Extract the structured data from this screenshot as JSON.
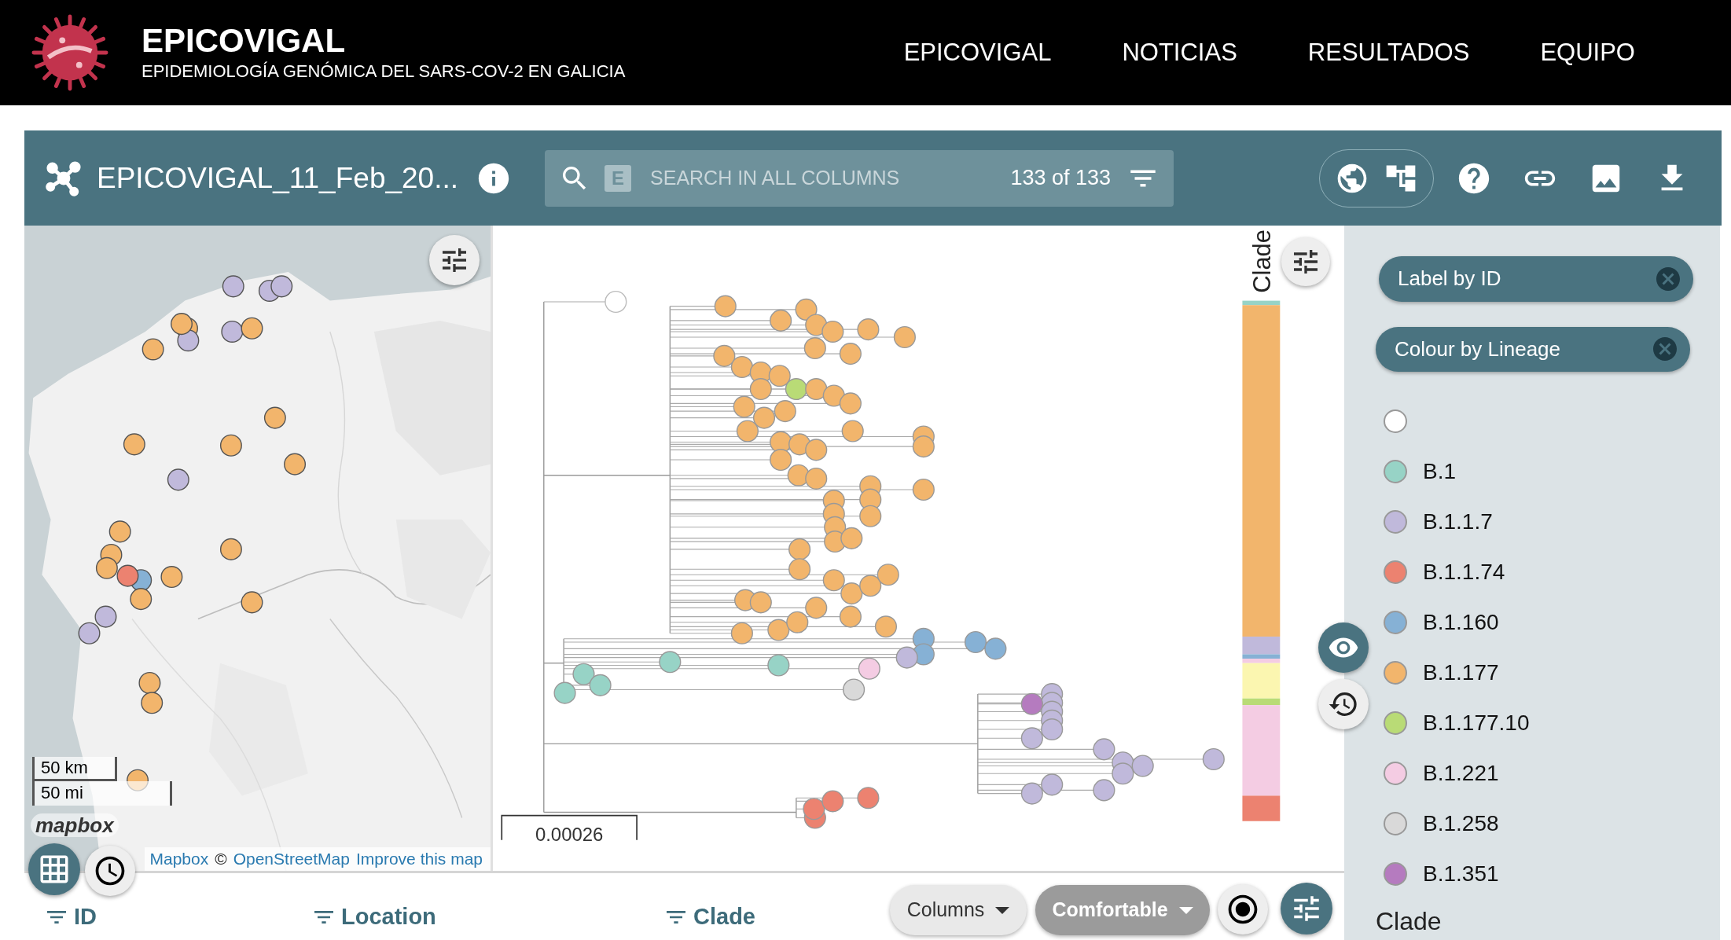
{
  "header": {
    "site_title": "EPICOVIGAL",
    "subtitle": "EPIDEMIOLOGÍA GENÓMICA DEL SARS-COV-2 EN GALICIA",
    "nav": [
      {
        "label": "EPICOVIGAL"
      },
      {
        "label": "NOTICIAS"
      },
      {
        "label": "RESULTADOS"
      },
      {
        "label": "EQUIPO"
      }
    ]
  },
  "toolbar": {
    "title": "EPICOVIGAL_11_Feb_20...",
    "search": {
      "badge": "E",
      "placeholder": "SEARCH IN ALL COLUMNS",
      "count": "133 of 133"
    }
  },
  "map": {
    "scale": [
      "50 km",
      "50 mi"
    ],
    "logo": "mapbox",
    "attribution": [
      {
        "text": "Mapbox",
        "kind": "link"
      },
      {
        "text": "©",
        "kind": "text"
      },
      {
        "text": "OpenStreetMap",
        "kind": "link"
      },
      {
        "text": "Improve this map",
        "kind": "link"
      }
    ]
  },
  "tree": {
    "scale_label": "0.00026",
    "strip_label": "Clade"
  },
  "legend": {
    "chips": [
      "Label by ID",
      "Colour by Lineage"
    ],
    "items": [
      {
        "color": "#ffffff"
      },
      {
        "label": "B.1",
        "color": "#97d3c6"
      },
      {
        "label": "B.1.1.7",
        "color": "#c0b9db"
      },
      {
        "label": "B.1.1.74",
        "color": "#ec8270"
      },
      {
        "label": "B.1.160",
        "color": "#86b1d5"
      },
      {
        "label": "B.1.177",
        "color": "#f2b56c"
      },
      {
        "label": "B.1.177.10",
        "color": "#b9db76"
      },
      {
        "label": "B.1.221",
        "color": "#f4cce3"
      },
      {
        "label": "B.1.258",
        "color": "#d9d9d9"
      },
      {
        "label": "B.1.351",
        "color": "#b57bbf"
      }
    ],
    "heading": "Clade"
  },
  "view_buttons": [
    {
      "kind": "eye",
      "selected": true
    },
    {
      "kind": "history",
      "selected": false
    }
  ],
  "table": {
    "columns": [
      "ID",
      "Location",
      "Clade"
    ]
  },
  "table_controls": {
    "columns_button": "Columns",
    "density_button": "Comfortable"
  }
}
